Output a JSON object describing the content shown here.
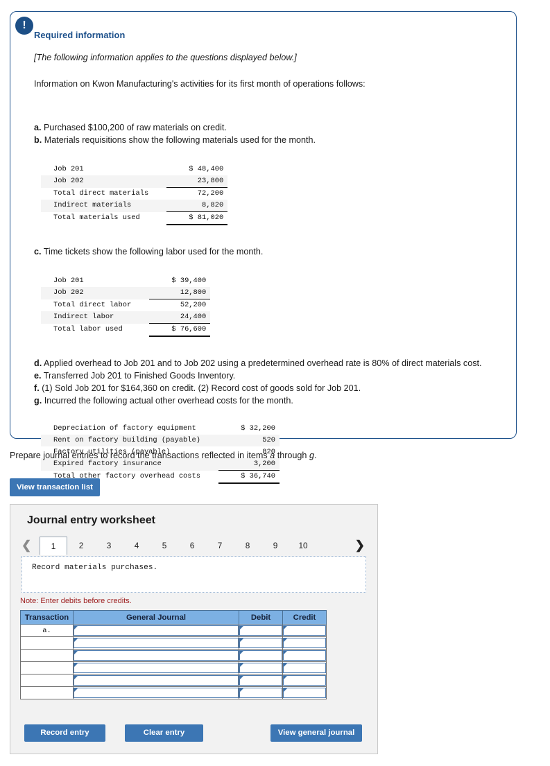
{
  "info_panel": {
    "icon": "exclamation-icon",
    "title": "Required information",
    "applies_note": "[The following information applies to the questions displayed below.]",
    "intro": "Information on Kwon Manufacturing's activities for its first month of operations follows:",
    "items": [
      {
        "marker": "a.",
        "text": "Purchased $100,200 of raw materials on credit."
      },
      {
        "marker": "b.",
        "text": "Materials requisitions show the following materials used for the month."
      },
      {
        "marker": "c.",
        "text": "Time tickets show the following labor used for the month."
      },
      {
        "marker": "d.",
        "text": "Applied overhead to Job 201 and to Job 202 using a predetermined overhead rate is 80% of direct materials cost."
      },
      {
        "marker": "e.",
        "text": "Transferred Job 201 to Finished Goods Inventory."
      },
      {
        "marker": "f.",
        "text": "(1) Sold Job 201 for $164,360 on credit. (2) Record cost of goods sold for Job 201."
      },
      {
        "marker": "g.",
        "text": "Incurred the following actual other overhead costs for the month."
      }
    ],
    "materials_table": [
      {
        "label": "Job 201",
        "value": "$ 48,400",
        "rule": "none",
        "shade": false
      },
      {
        "label": "Job 202",
        "value": "23,800",
        "rule": "ul",
        "shade": true
      },
      {
        "label": "Total direct materials",
        "value": "72,200",
        "rule": "none",
        "shade": false
      },
      {
        "label": "Indirect materials",
        "value": "8,820",
        "rule": "ul",
        "shade": true
      },
      {
        "label": "Total materials used",
        "value": "$ 81,020",
        "rule": "thick",
        "shade": false
      }
    ],
    "labor_table": [
      {
        "label": "Job 201",
        "value": "$ 39,400",
        "rule": "none",
        "shade": false
      },
      {
        "label": "Job 202",
        "value": "12,800",
        "rule": "ul",
        "shade": true
      },
      {
        "label": "Total direct labor",
        "value": "52,200",
        "rule": "none",
        "shade": false
      },
      {
        "label": "Indirect labor",
        "value": "24,400",
        "rule": "ul",
        "shade": true
      },
      {
        "label": "Total labor used",
        "value": "$ 76,600",
        "rule": "thick",
        "shade": false
      }
    ],
    "overhead_table": [
      {
        "label": "Depreciation of factory equipment",
        "value": "$ 32,200",
        "rule": "none",
        "shade": false
      },
      {
        "label": "Rent on factory building (payable)",
        "value": "520",
        "rule": "none",
        "shade": true
      },
      {
        "label": "Factory utilities (payable)",
        "value": "820",
        "rule": "none",
        "shade": false
      },
      {
        "label": "Expired factory insurance",
        "value": "3,200",
        "rule": "ul",
        "shade": true
      },
      {
        "label": "Total other factory overhead costs",
        "value": "$ 36,740",
        "rule": "thick",
        "shade": false
      }
    ]
  },
  "prepare": {
    "text_before": "Prepare journal entries to record the transactions reflected in items ",
    "italic_a": "a",
    "text_mid": " through ",
    "italic_g": "g",
    "text_after": "."
  },
  "buttons": {
    "view_transaction_list": "View transaction list",
    "record_entry": "Record entry",
    "clear_entry": "Clear entry",
    "view_general_journal": "View general journal"
  },
  "worksheet": {
    "title": "Journal entry worksheet",
    "prev_arrow": "chevron-left-icon",
    "next_arrow": "chevron-right-icon",
    "tabs": [
      "1",
      "2",
      "3",
      "4",
      "5",
      "6",
      "7",
      "8",
      "9",
      "10"
    ],
    "active_tab": "1",
    "prompt": "Record materials purchases.",
    "note": "Note: Enter debits before credits.",
    "table": {
      "headers": [
        "Transaction",
        "General Journal",
        "Debit",
        "Credit"
      ],
      "rows": [
        {
          "transaction": "a.",
          "general_journal": "",
          "debit": "",
          "credit": ""
        },
        {
          "transaction": "",
          "general_journal": "",
          "debit": "",
          "credit": ""
        },
        {
          "transaction": "",
          "general_journal": "",
          "debit": "",
          "credit": ""
        },
        {
          "transaction": "",
          "general_journal": "",
          "debit": "",
          "credit": ""
        },
        {
          "transaction": "",
          "general_journal": "",
          "debit": "",
          "credit": ""
        },
        {
          "transaction": "",
          "general_journal": "",
          "debit": "",
          "credit": ""
        }
      ]
    }
  },
  "colors": {
    "panel_border": "#1b4f8a",
    "heading_blue": "#1b4f8a",
    "button_blue": "#3c76b4",
    "table_header_blue": "#7cb0e3",
    "note_red": "#9e2020"
  }
}
